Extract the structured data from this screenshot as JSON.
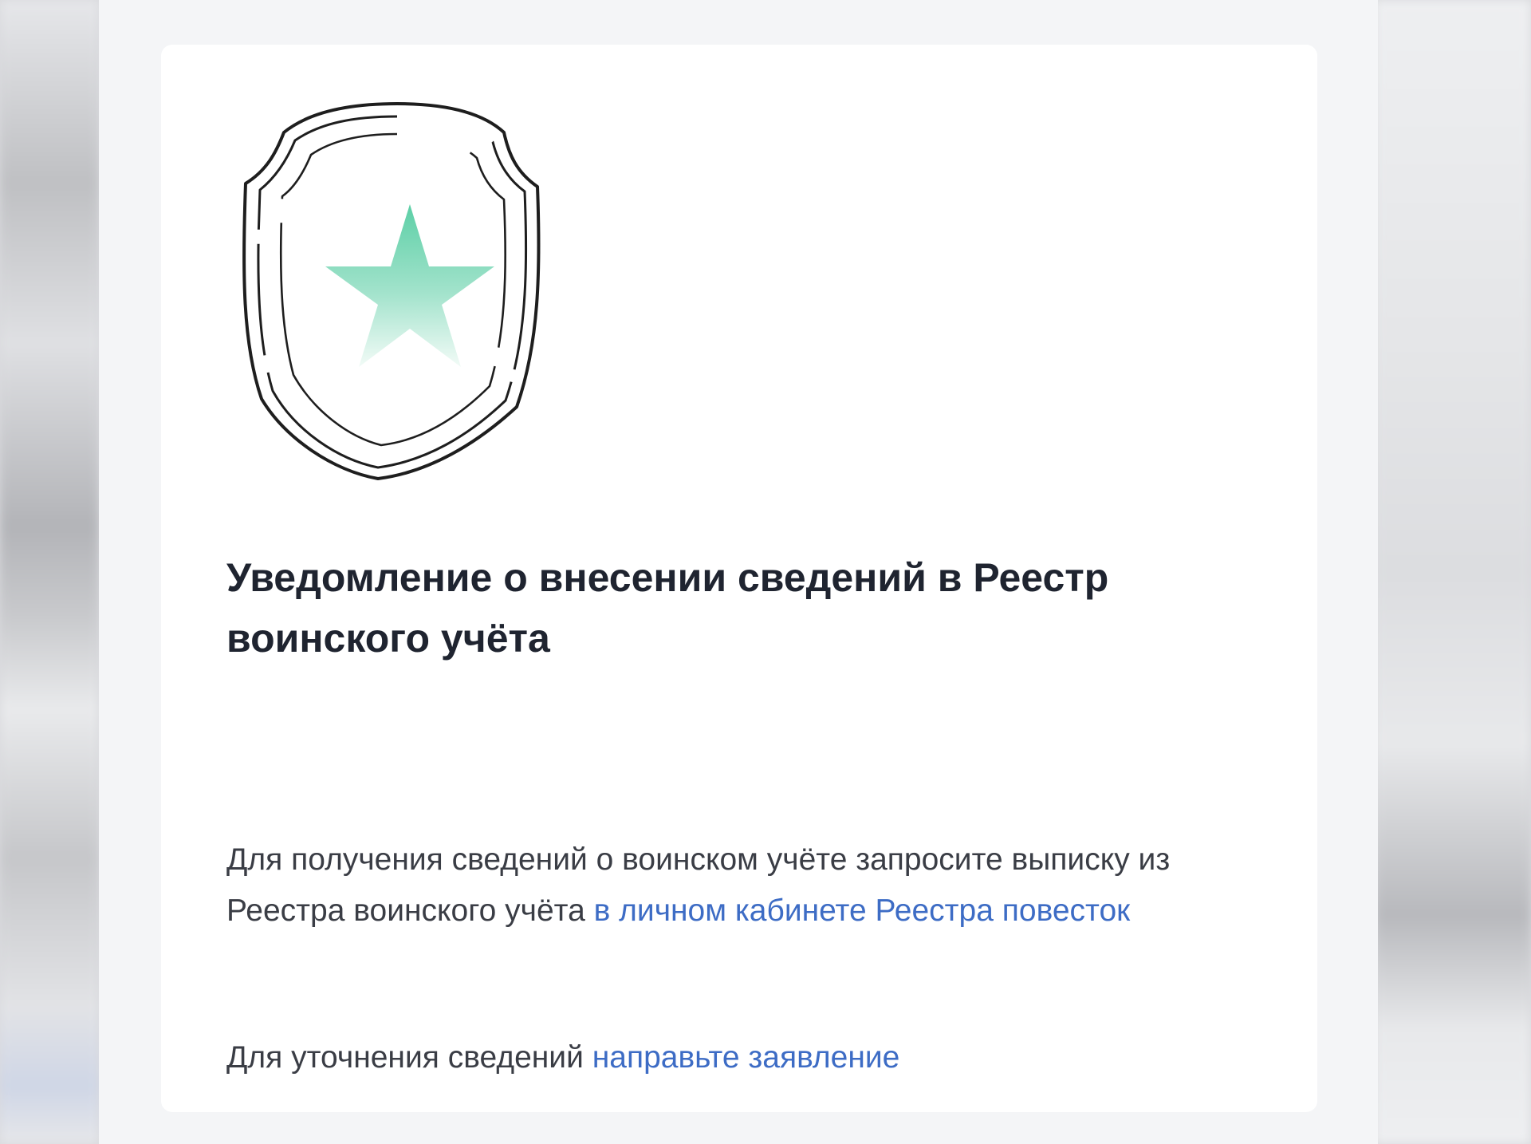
{
  "notice": {
    "title": "Уведомление о внесении сведений в Реестр воинского учёта",
    "paragraph1": {
      "text": "Для получения сведений о воинском учёте запросите выписку из Реестра воинского учёта ",
      "link": "в личном кабинете Реестра повесток"
    },
    "paragraph2": {
      "text": "Для уточнения сведений ",
      "link": "направьте заявление"
    }
  },
  "colors": {
    "link": "#3d6cc5",
    "star": "#6fd3b0",
    "title": "#1f2430"
  },
  "icons": {
    "shield": "shield-star-icon"
  }
}
